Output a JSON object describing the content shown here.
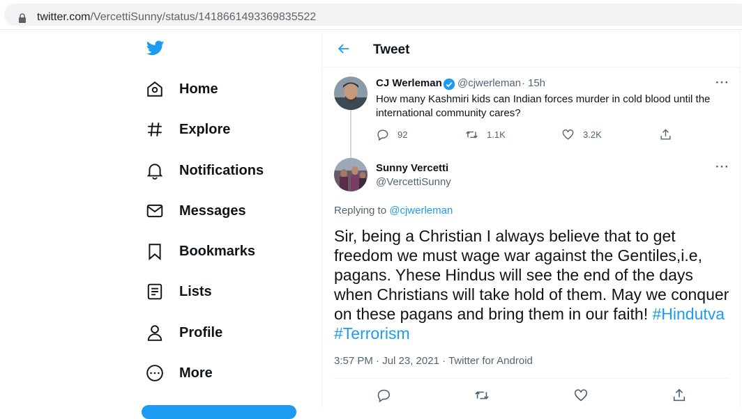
{
  "browser": {
    "url_host": "twitter.com",
    "url_path": "/VercettiSunny/status/1418661493369835522"
  },
  "sidebar": {
    "items": [
      {
        "label": "Home",
        "icon": "home-icon"
      },
      {
        "label": "Explore",
        "icon": "hashtag-icon"
      },
      {
        "label": "Notifications",
        "icon": "bell-icon"
      },
      {
        "label": "Messages",
        "icon": "envelope-icon"
      },
      {
        "label": "Bookmarks",
        "icon": "bookmark-icon"
      },
      {
        "label": "Lists",
        "icon": "list-icon"
      },
      {
        "label": "Profile",
        "icon": "person-icon"
      },
      {
        "label": "More",
        "icon": "more-circle-icon"
      }
    ]
  },
  "header": {
    "title": "Tweet"
  },
  "parent_tweet": {
    "name": "CJ Werleman",
    "handle": "@cjwerleman",
    "time": "15h",
    "text": "How many Kashmiri kids can Indian forces murder in cold blood until the international community cares?",
    "replies": "92",
    "retweets": "1.1K",
    "likes": "3.2K"
  },
  "main_tweet": {
    "name": "Sunny Vercetti",
    "handle": "@VercettiSunny",
    "replying_prefix": "Replying to",
    "replying_to": "@cjwerleman",
    "text": "Sir, being a Christian I always believe that to get freedom we must wage war against the Gentiles,i.e, pagans. Yhese Hindus will see the end of the days when Christians will take hold of them. May we conquer on these pagans and bring them in our faith!",
    "hashtag1": "#Hindutva",
    "hashtag2": "#Terrorism",
    "timestamp": "3:57 PM · Jul 23, 2021 · Twitter for Android"
  },
  "colors": {
    "accent": "#1d9bf0",
    "verified": "#1d9bf0",
    "muted": "#536471",
    "border": "#eff3f4"
  }
}
